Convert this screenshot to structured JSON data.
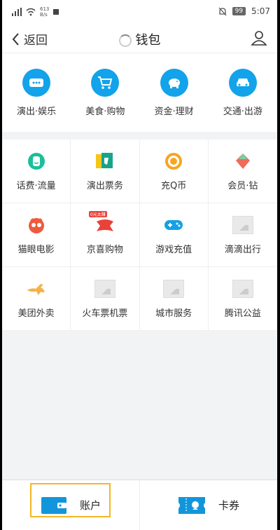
{
  "status": {
    "speed_top": "613",
    "speed_unit": "B/s",
    "battery": "99",
    "time": "5:07"
  },
  "nav": {
    "back_label": "返回",
    "title": "钱包"
  },
  "top_items": [
    {
      "label": "演出·娱乐",
      "icon": "chat-bubble-icon"
    },
    {
      "label": "美食·购物",
      "icon": "cart-icon"
    },
    {
      "label": "资金·理财",
      "icon": "piggy-bank-icon"
    },
    {
      "label": "交通·出游",
      "icon": "car-icon"
    }
  ],
  "services": [
    {
      "label": "话费·流量",
      "icon": "phone-charge-icon"
    },
    {
      "label": "演出票务",
      "icon": "ticket-icon"
    },
    {
      "label": "充Q币",
      "icon": "q-coin-icon"
    },
    {
      "label": "会员·钻",
      "icon": "diamond-icon"
    },
    {
      "label": "猫眼电影",
      "icon": "maoyan-icon"
    },
    {
      "label": "京喜购物",
      "icon": "jingxi-icon",
      "badge": "0元太赚"
    },
    {
      "label": "游戏充值",
      "icon": "gamepad-icon"
    },
    {
      "label": "滴滴出行",
      "icon": "image-placeholder-icon"
    },
    {
      "label": "美团外卖",
      "icon": "kangaroo-icon"
    },
    {
      "label": "火车票机票",
      "icon": "image-placeholder-icon"
    },
    {
      "label": "城市服务",
      "icon": "image-placeholder-icon"
    },
    {
      "label": "腾讯公益",
      "icon": "image-placeholder-icon"
    }
  ],
  "bottom": {
    "account_label": "账户",
    "coupon_label": "卡券"
  },
  "colors": {
    "accent": "#12a3ea",
    "highlight": "#f5b625"
  }
}
